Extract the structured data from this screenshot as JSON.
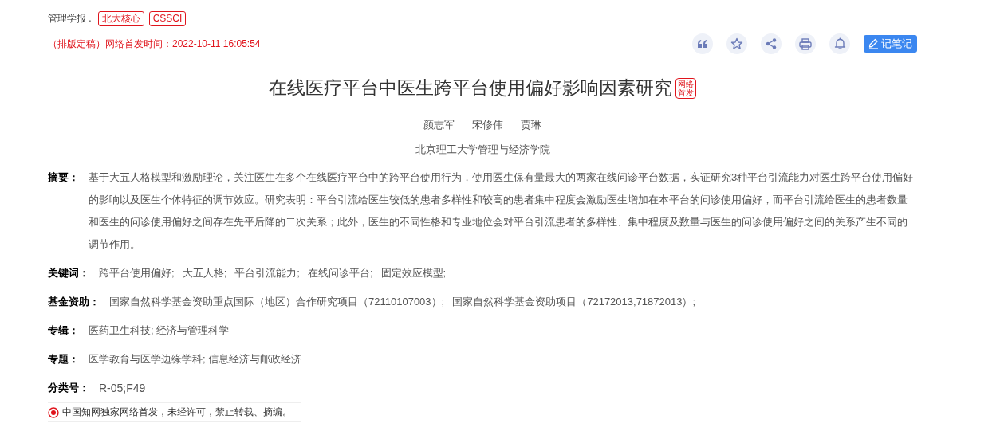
{
  "journal": {
    "name": "管理学报 .",
    "badges": [
      "北大核心",
      "CSSCI"
    ]
  },
  "publish_info": "（排版定稿）网络首发时间：2022-10-11 16:05:54",
  "toolbar": {
    "icons": [
      {
        "kind": "quote"
      },
      {
        "kind": "star"
      },
      {
        "kind": "share"
      },
      {
        "kind": "print"
      },
      {
        "kind": "bell"
      }
    ],
    "note_button": "记笔记"
  },
  "title": "在线医疗平台中医生跨平台使用偏好影响因素研究",
  "title_badge": "网络首发",
  "authors": [
    "颜志军",
    "宋修伟",
    "贾琳"
  ],
  "affiliation": "北京理工大学管理与经济学院",
  "fields": [
    {
      "label": "摘要：",
      "kind": "text",
      "text": "基于大五人格模型和激励理论，关注医生在多个在线医疗平台中的跨平台使用行为，使用医生保有量最大的两家在线问诊平台数据，实证研究3种平台引流能力对医生跨平台使用偏好的影响以及医生个体特征的调节效应。研究表明：平台引流给医生较低的患者多样性和较高的患者集中程度会激励医生增加在本平台的问诊使用偏好，而平台引流给医生的患者数量和医生的问诊使用偏好之间存在先平后降的二次关系；此外，医生的不同性格和专业地位会对平台引流患者的多样性、集中程度及数量与医生的问诊使用偏好之间的关系产生不同的调节作用。"
    },
    {
      "label": "关键词：",
      "kind": "links",
      "items": [
        "跨平台使用偏好;",
        "大五人格;",
        "平台引流能力;",
        "在线问诊平台;",
        "固定效应模型;"
      ]
    },
    {
      "label": "基金资助：",
      "kind": "links",
      "items": [
        "国家自然科学基金资助重点国际（地区）合作研究项目（72110107003）;",
        "国家自然科学基金资助项目（72172013,71872013）;"
      ]
    },
    {
      "label": "专辑：",
      "kind": "plain",
      "text": "医药卫生科技; 经济与管理科学"
    },
    {
      "label": "专题：",
      "kind": "plain",
      "text": "医学教育与医学边缘学科; 信息经济与邮政经济"
    },
    {
      "label": "分类号：",
      "kind": "code",
      "text": "R-05;F49"
    }
  ],
  "notice": "中国知网独家网络首发，未经许可，禁止转载、摘编。"
}
